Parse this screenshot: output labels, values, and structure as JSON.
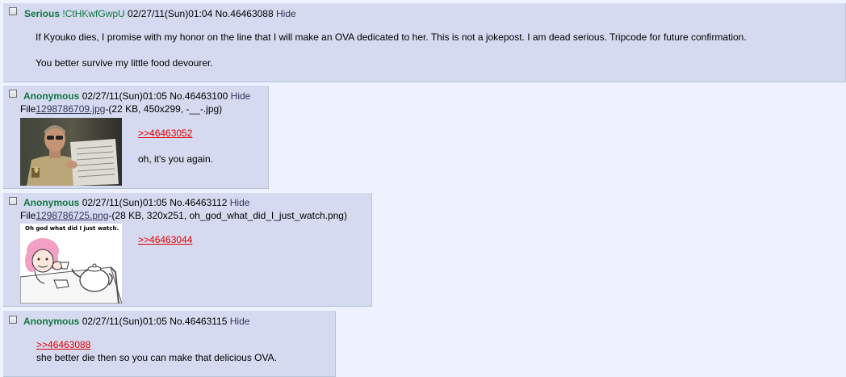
{
  "posts": [
    {
      "name": "Serious",
      "tripcode": "!CtHKwfGwpU",
      "datetime": "02/27/11(Sun)01:04",
      "number": "No.46463088",
      "hide_label": "Hide",
      "message_lines": [
        "If Kyouko dies, I promise with my honor on the line that I will make an OVA dedicated to her. This is not a jokepost. I am dead serious. Tripcode for future confirmation.",
        "You better survive my little food devourer."
      ]
    },
    {
      "name": "Anonymous",
      "datetime": "02/27/11(Sun)01:05",
      "number": "No.46463100",
      "hide_label": "Hide",
      "file_prefix": "File",
      "file_name": "1298786709.jpg",
      "file_meta": "-(22 KB, 450x299, -__-.jpg)",
      "quote_link": ">>46463052",
      "message": "oh, it's you again."
    },
    {
      "name": "Anonymous",
      "datetime": "02/27/11(Sun)01:05",
      "number": "No.46463112",
      "hide_label": "Hide",
      "file_prefix": "File",
      "file_name": "1298786725.png",
      "file_meta": "-(28 KB, 320x251, oh_god_what_did_I_just_watch.png)",
      "quote_link": ">>46463044",
      "thumb_caption": "Oh god what did I just watch."
    },
    {
      "name": "Anonymous",
      "datetime": "02/27/11(Sun)01:05",
      "number": "No.46463115",
      "hide_label": "Hide",
      "quote_link": ">>46463088",
      "message": "she better die then so you can make that delicious OVA."
    }
  ]
}
